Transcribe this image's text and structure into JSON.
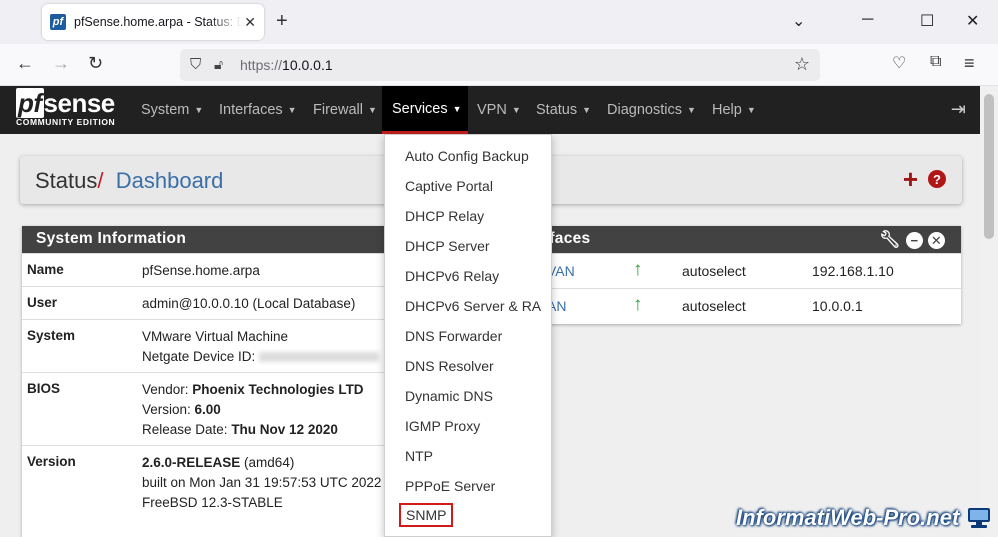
{
  "browser": {
    "tab_title": "pfSense.home.arpa - Status: Dashboard",
    "favicon_text": "pf",
    "url_protocol": "https://",
    "url_host": "10.0.0.1"
  },
  "pfsense": {
    "logo": "pfsense",
    "logo_pf": "pf",
    "logo_rest": "sense",
    "edition": "COMMUNITY EDITION",
    "menu": [
      "System",
      "Interfaces",
      "Firewall",
      "Services",
      "VPN",
      "Status",
      "Diagnostics",
      "Help"
    ],
    "active_menu": "Services"
  },
  "breadcrumb": {
    "section": "Status",
    "separator": "/",
    "page": "Dashboard"
  },
  "system_info": {
    "title": "System Information",
    "rows": [
      {
        "label": "Name",
        "lines": [
          "pfSense.home.arpa"
        ]
      },
      {
        "label": "User",
        "lines": [
          "admin@10.0.0.10 (Local Database)"
        ]
      },
      {
        "label": "System",
        "lines": [
          "VMware Virtual Machine",
          "Netgate Device ID:"
        ]
      },
      {
        "label": "BIOS",
        "lines": [
          "Vendor: ",
          "Phoenix Technologies LTD",
          "Version: ",
          "6.00",
          "Release Date: ",
          "Thu Nov 12 2020"
        ]
      },
      {
        "label": "Version",
        "lines": [
          "2.6.0-RELEASE",
          " (amd64)",
          "built on Mon Jan 31 19:57:53 UTC 2022",
          "FreeBSD 12.3-STABLE"
        ]
      }
    ]
  },
  "interfaces": {
    "title": "rfaces",
    "rows": [
      {
        "name": "VAN",
        "media": "autoselect",
        "ip": "192.168.1.10"
      },
      {
        "name": "AN",
        "media": "autoselect",
        "ip": "10.0.0.1"
      }
    ]
  },
  "services_menu": [
    "Auto Config Backup",
    "Captive Portal",
    "DHCP Relay",
    "DHCP Server",
    "DHCPv6 Relay",
    "DHCPv6 Server & RA",
    "DNS Forwarder",
    "DNS Resolver",
    "Dynamic DNS",
    "IGMP Proxy",
    "NTP",
    "PPPoE Server",
    "SNMP"
  ],
  "watermark": "InformatiWeb-Pro.net",
  "colors": {
    "nav_bg": "#212121",
    "active_underline": "#c41e1e",
    "link_blue": "#3a6fa8",
    "up_green": "#2e9e3c",
    "highlight_red": "#d11a1a"
  }
}
